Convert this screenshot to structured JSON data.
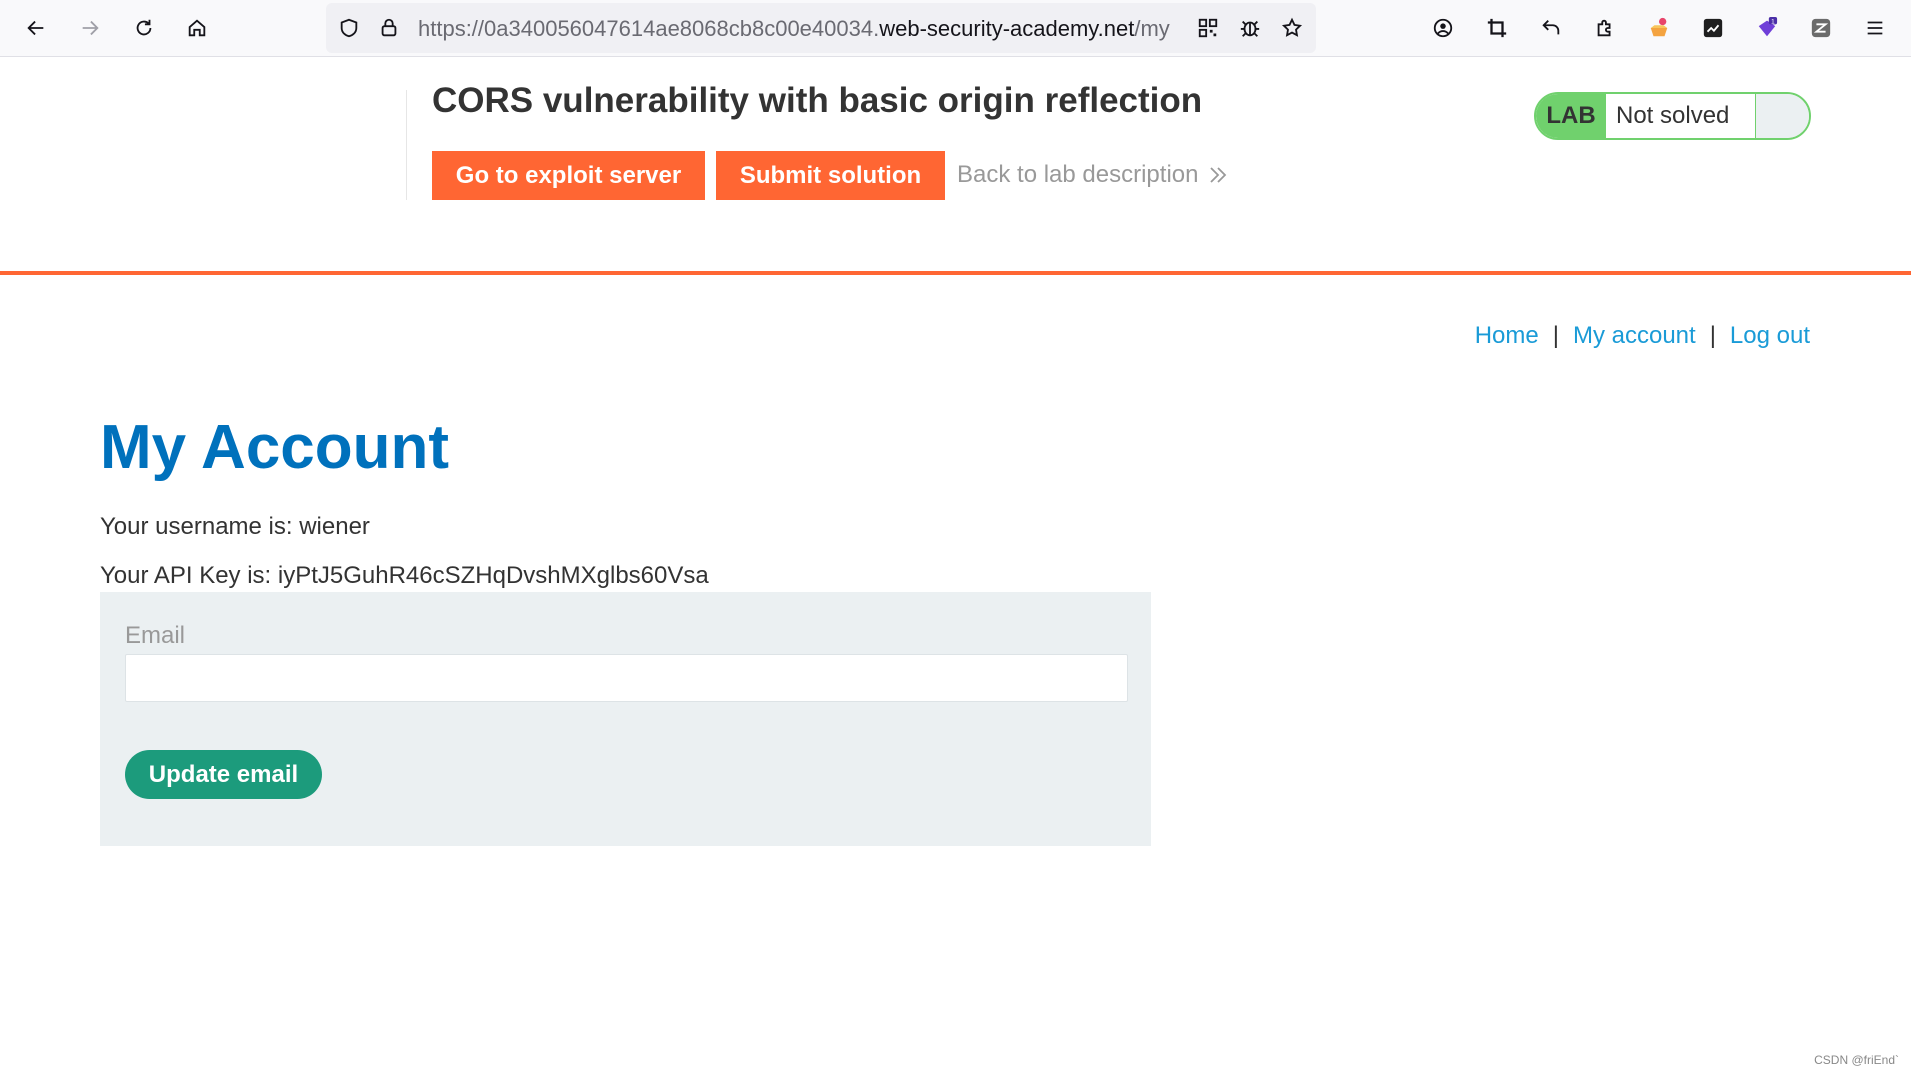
{
  "browser": {
    "url_prefix": "https://0a340056047614ae8068cb8c00e40034.",
    "url_domain": "web-security-academy.net",
    "url_suffix": "/my"
  },
  "lab": {
    "title": "CORS vulnerability with basic origin reflection",
    "exploit_button": "Go to exploit server",
    "submit_button": "Submit solution",
    "back_link": "Back to lab description",
    "badge_label": "LAB",
    "status": "Not solved"
  },
  "nav": {
    "home": "Home",
    "separator": "|",
    "my_account": "My account",
    "log_out": "Log out"
  },
  "account": {
    "heading": "My Account",
    "username_line": "Your username is: wiener",
    "api_key_line": "Your API Key is: iyPtJ5GuhR46cSZHqDvshMXglbs60Vsa",
    "email_label": "Email",
    "email_value": "",
    "update_button": "Update email"
  },
  "watermark": "CSDN @friEnd`",
  "colors": {
    "accent_orange": "#ff6633",
    "lab_green": "#70d16d",
    "link_blue": "#1a9bd7",
    "heading_blue": "#0071bc",
    "button_teal": "#1c9b7c"
  }
}
